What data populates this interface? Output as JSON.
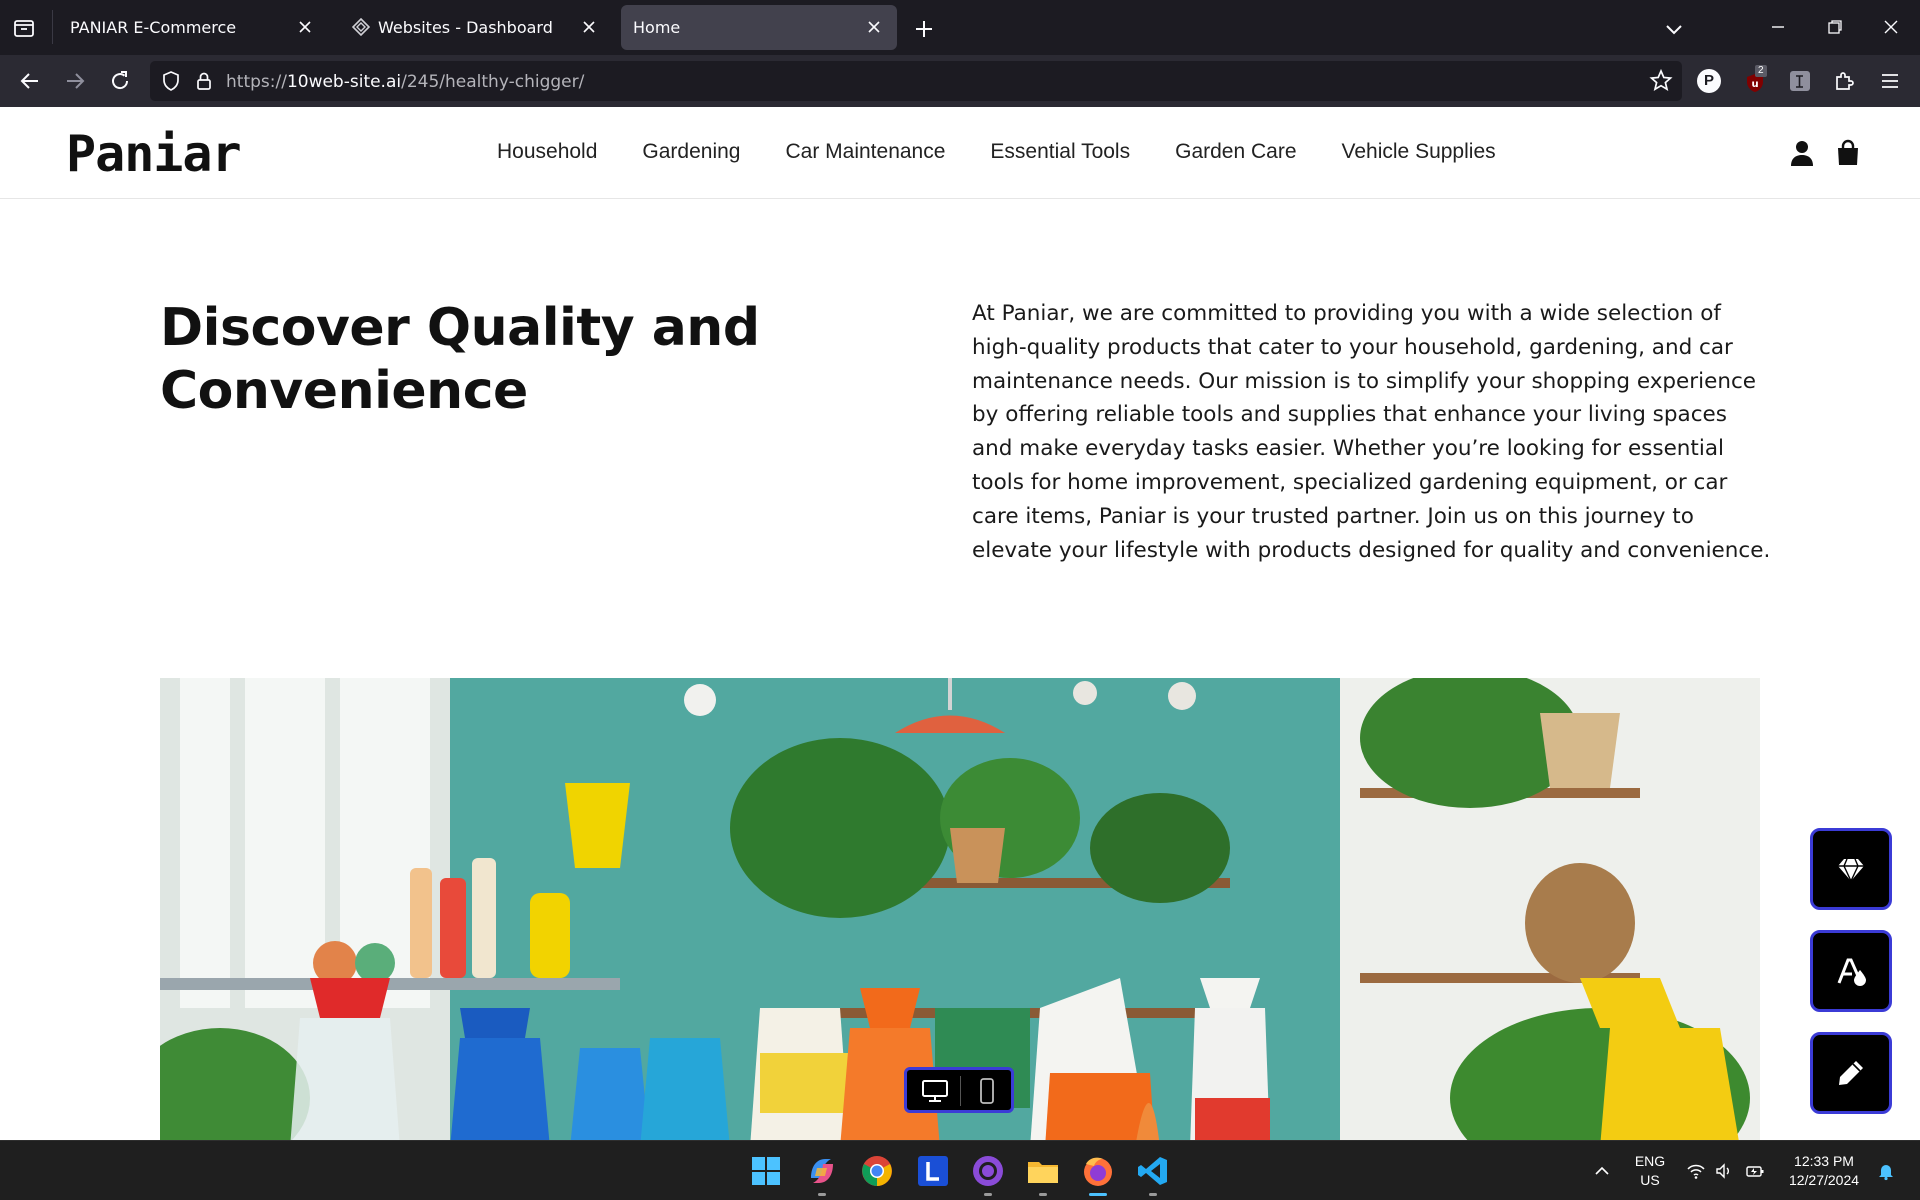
{
  "browser": {
    "tabs": [
      {
        "title": "PANIAR E-Commerce",
        "active": false
      },
      {
        "title": "Websites - Dashboard",
        "active": false
      },
      {
        "title": "Home",
        "active": true
      }
    ],
    "url_prefix": "https://",
    "url_domain": "10web-site.ai",
    "url_path": "/245/healthy-chigger/",
    "extension_badge": "2",
    "profile_letter": "P"
  },
  "site": {
    "logo": "Paniar",
    "nav": [
      "Household",
      "Gardening",
      "Car Maintenance",
      "Essential Tools",
      "Garden Care",
      "Vehicle Supplies"
    ],
    "hero_title": "Discover Quality and Convenience",
    "hero_text": "At Paniar, we are committed to providing you with a wide selection of high-quality products that cater to your household, gardening, and car maintenance needs. Our mission is to simplify your shopping experience by offering reliable tools and supplies that enhance your living spaces and make everyday tasks easier. Whether you’re looking for essential tools for home improvement, specialized gardening equipment, or car care items, Paniar is your trusted partner. Join us on this journey to elevate your lifestyle with products designed for quality and convenience."
  },
  "editor_tools": [
    "diamond-icon",
    "style-icon",
    "pencil-icon"
  ],
  "device_toggle": [
    "desktop-icon",
    "mobile-icon"
  ],
  "taskbar": {
    "apps": [
      "start-icon",
      "copilot-icon",
      "chrome-icon",
      "l-app-icon",
      "github-desktop-icon",
      "file-explorer-icon",
      "firefox-icon",
      "vscode-icon"
    ],
    "lang_line1": "ENG",
    "lang_line2": "US",
    "time": "12:33 PM",
    "date": "12/27/2024"
  },
  "colors": {
    "accent_border": "#3b3bd6",
    "tab_active": "#42414d",
    "chrome_dark": "#1c1b22",
    "taskbar_active": "#4cc2ff"
  }
}
